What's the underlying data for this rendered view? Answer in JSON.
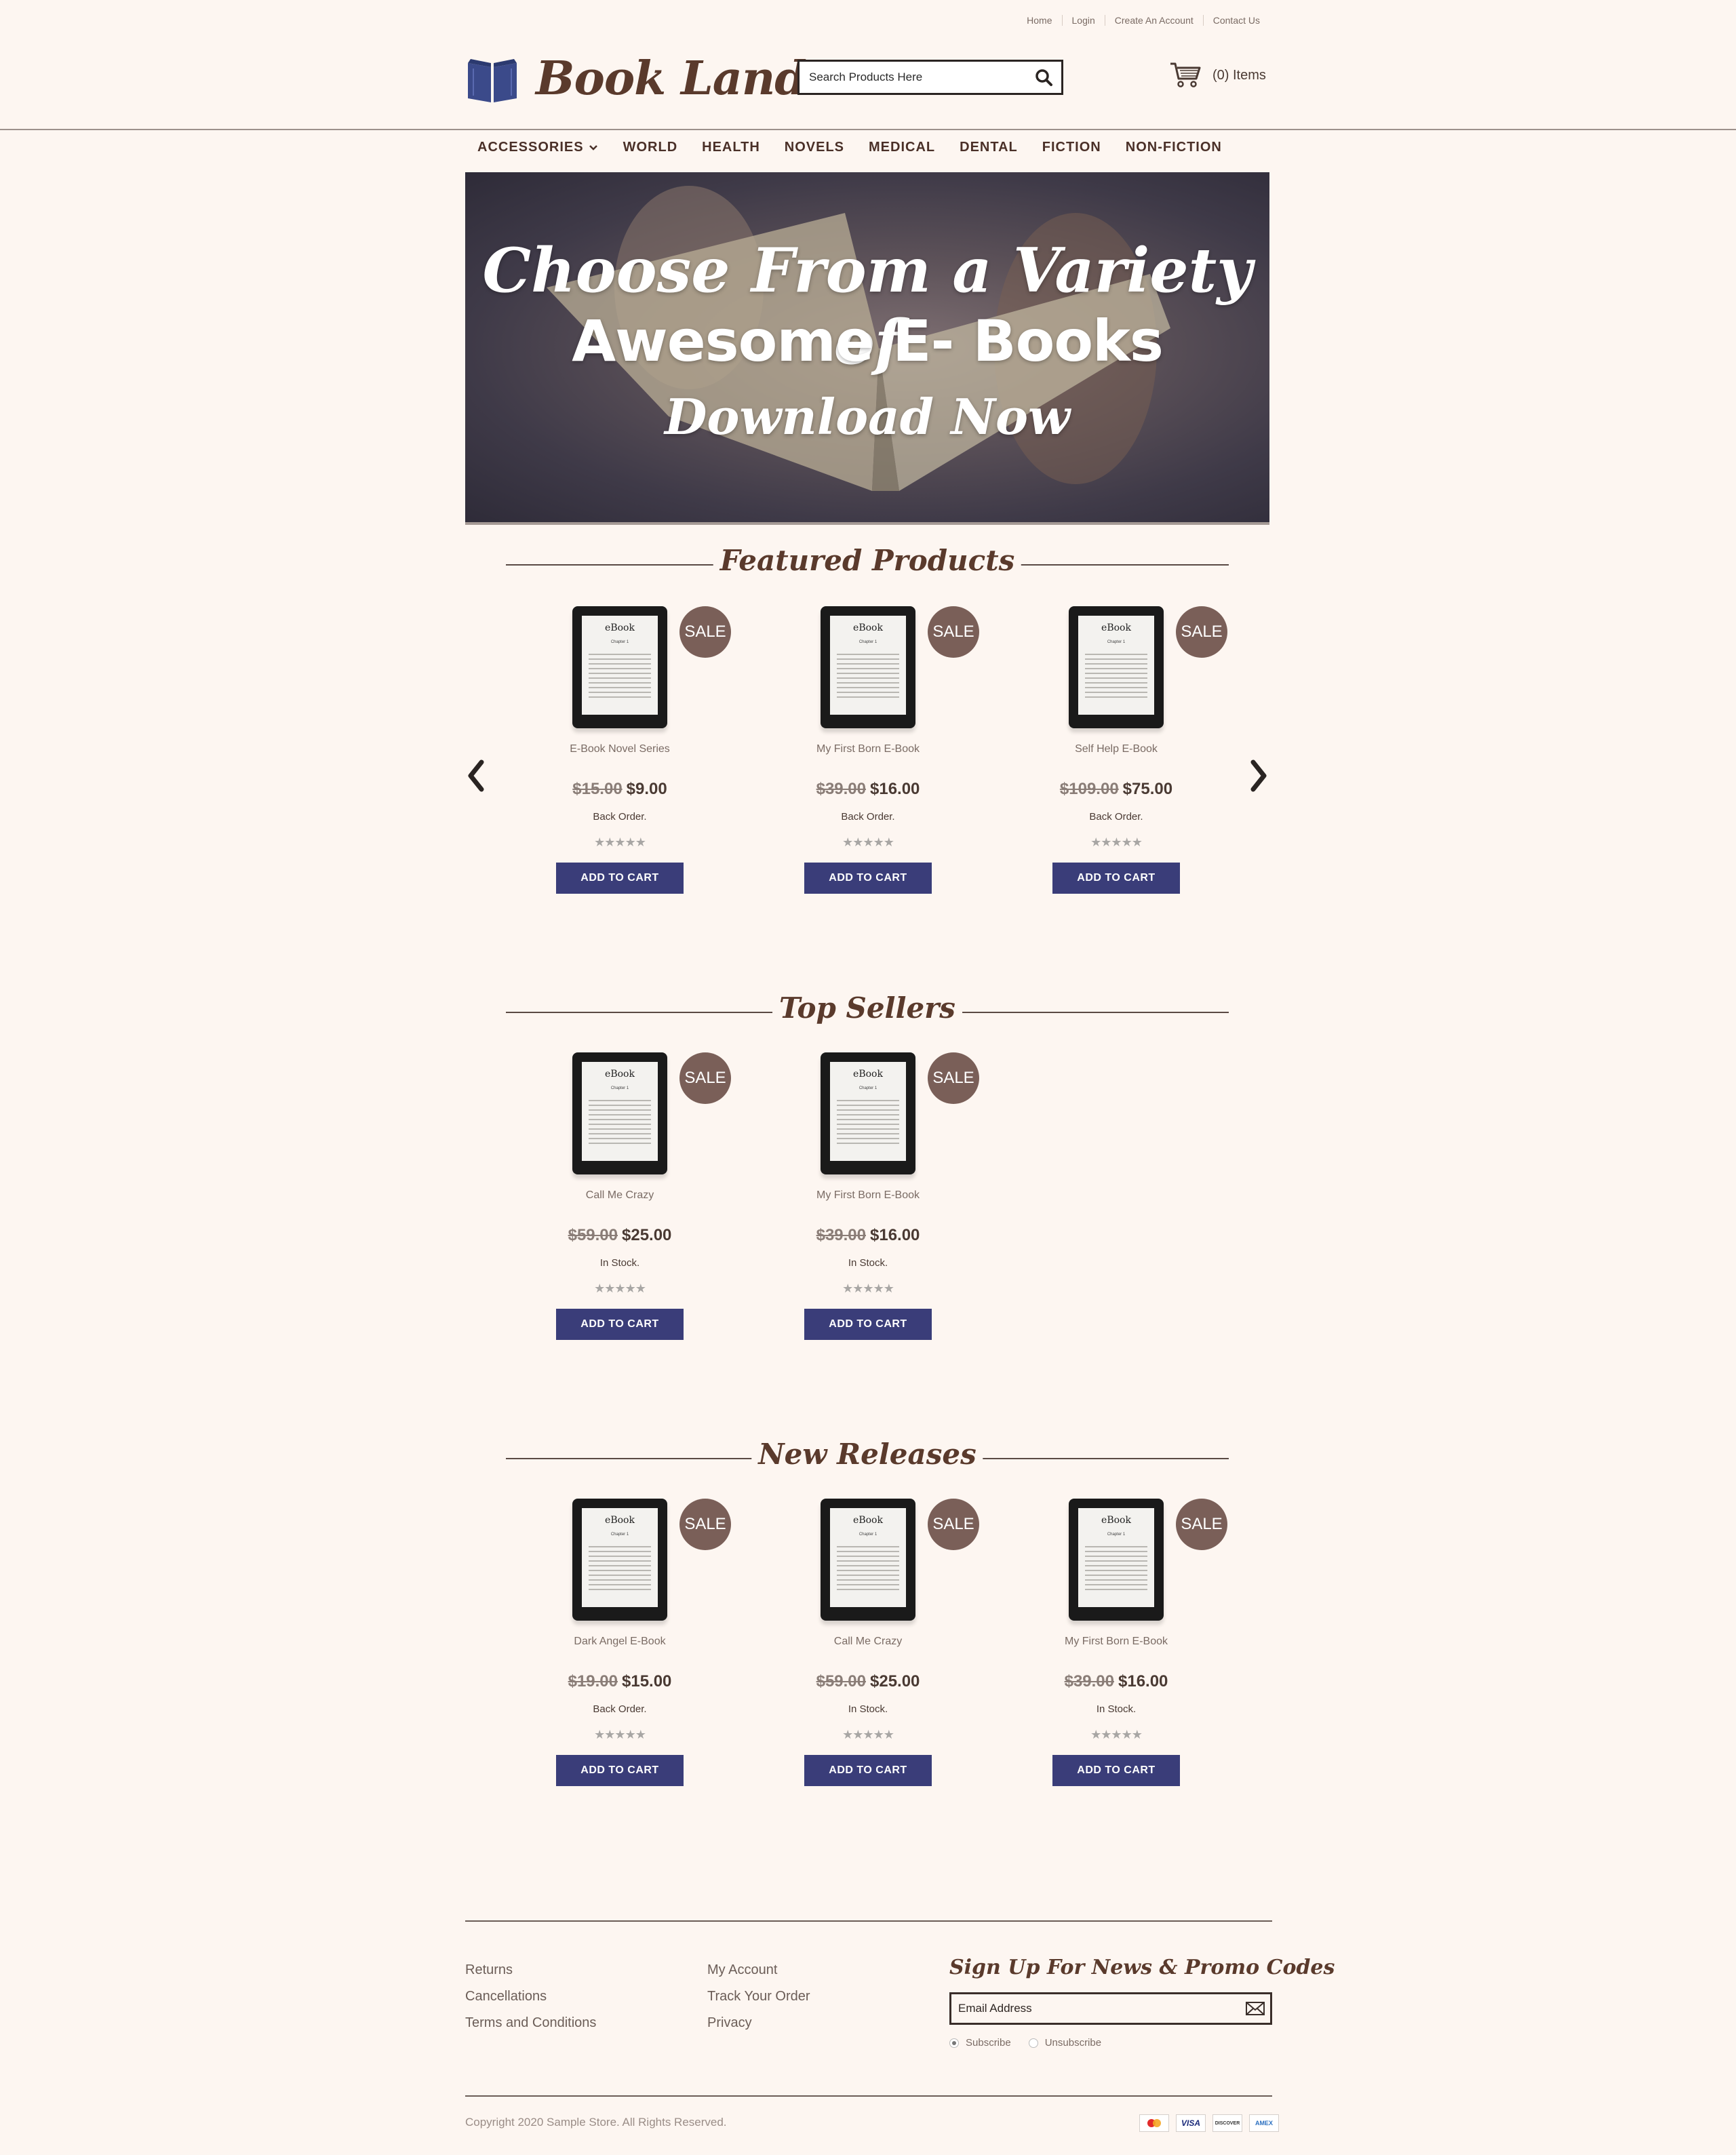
{
  "toplinks": [
    "Home",
    "Login",
    "Create An Account",
    "Contact Us"
  ],
  "logo": {
    "text": "Book Land",
    "color": "#3b4a8a"
  },
  "search": {
    "placeholder": "Search Products Here"
  },
  "cart": {
    "label": "(0) Items"
  },
  "nav": [
    "ACCESSORIES",
    "WORLD",
    "HEALTH",
    "NOVELS",
    "MEDICAL",
    "DENTAL",
    "FICTION",
    "NON-FICTION"
  ],
  "hero": {
    "line1": "Choose From a Variety of",
    "line2": "Awesome E- Books",
    "line3": "Download Now"
  },
  "sections": [
    {
      "title": "Featured Products",
      "products": [
        {
          "name": "E-Book Novel Series",
          "old_price": "$15.00",
          "price": "$9.00",
          "stock": "Back Order."
        },
        {
          "name": "My First Born E-Book",
          "old_price": "$39.00",
          "price": "$16.00",
          "stock": "Back Order."
        },
        {
          "name": "Self Help E-Book",
          "old_price": "$109.00",
          "price": "$75.00",
          "stock": "Back Order."
        }
      ]
    },
    {
      "title": "Top Sellers",
      "products": [
        {
          "name": "Call Me Crazy",
          "old_price": "$59.00",
          "price": "$25.00",
          "stock": "In Stock."
        },
        {
          "name": "My First Born E-Book",
          "old_price": "$39.00",
          "price": "$16.00",
          "stock": "In Stock."
        }
      ]
    },
    {
      "title": "New Releases",
      "products": [
        {
          "name": "Dark Angel E-Book",
          "old_price": "$19.00",
          "price": "$15.00",
          "stock": "Back Order."
        },
        {
          "name": "Call Me Crazy",
          "old_price": "$59.00",
          "price": "$25.00",
          "stock": "In Stock."
        },
        {
          "name": "My First Born E-Book",
          "old_price": "$39.00",
          "price": "$16.00",
          "stock": "In Stock."
        }
      ]
    }
  ],
  "product_common": {
    "sale": "SALE",
    "add_to_cart": "ADD TO CART",
    "ebook": "eBook",
    "chapter": "Chapter 1",
    "stars": "★★★★★"
  },
  "footer": {
    "col1": [
      "Returns",
      "Cancellations",
      "Terms and Conditions"
    ],
    "col2": [
      "My Account",
      "Track Your Order",
      "Privacy"
    ],
    "signup_title": "Sign Up For News & Promo Codes",
    "email_placeholder": "Email Address",
    "subscribe": "Subscribe",
    "unsubscribe": "Unsubscribe",
    "copyright": "Copyright 2020 Sample Store. All Rights Reserved.",
    "cards": [
      "mastercard-icon",
      "visa-icon",
      "discover-icon",
      "amex-icon"
    ]
  },
  "colors": {
    "background": "#fdf6f1",
    "button": "#3a3d79",
    "sale_badge": "#7a5f58",
    "heading": "#5a3a2c"
  }
}
